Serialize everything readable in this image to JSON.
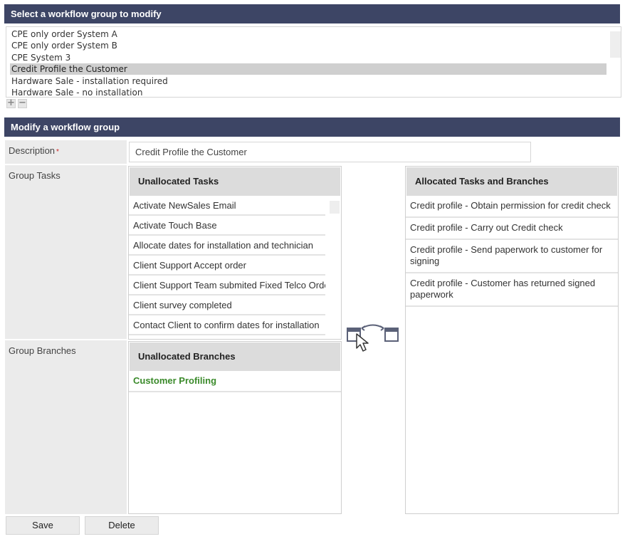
{
  "select_section": {
    "title": "Select a workflow group to modify",
    "items": [
      {
        "label": "CPE only order System A"
      },
      {
        "label": "CPE only order System B"
      },
      {
        "label": "CPE System 3"
      },
      {
        "label": "Credit Profile the Customer",
        "selected": true
      },
      {
        "label": "Hardware Sale - installation required"
      },
      {
        "label": "Hardware Sale - no installation"
      }
    ],
    "add_label": "+",
    "remove_label": "−"
  },
  "modify_section": {
    "title": "Modify a workflow group",
    "description_label": "Description",
    "required_mark": "*",
    "description_value": "Credit Profile the Customer",
    "group_tasks_label": "Group Tasks",
    "group_branches_label": "Group Branches"
  },
  "unallocated_tasks": {
    "title": "Unallocated Tasks",
    "items": [
      "Activate NewSales Email",
      "Activate Touch Base",
      "Allocate dates for installation and technician",
      "Client Support Accept order",
      "Client Support Team submited Fixed Telco Order",
      "Client survey completed",
      "Contact Client to confirm dates for installation"
    ]
  },
  "allocated_tasks": {
    "title": "Allocated Tasks and Branches",
    "items": [
      "Credit profile - Obtain permission for credit check",
      "Credit profile - Carry out Credit check",
      "Credit profile - Send paperwork to customer for signing",
      "Credit profile - Customer has returned signed paperwork"
    ]
  },
  "unallocated_branches": {
    "title": "Unallocated Branches",
    "items": [
      "Customer Profiling"
    ]
  },
  "icons": {
    "transfer": "drag-transfer-icon",
    "add": "plus-icon",
    "remove": "minus-icon"
  },
  "colors": {
    "header_bg": "#3d4565",
    "branch_text": "#3a8a2a",
    "selected_row": "#cfcfcf"
  },
  "buttons": {
    "save": "Save",
    "delete": "Delete"
  }
}
